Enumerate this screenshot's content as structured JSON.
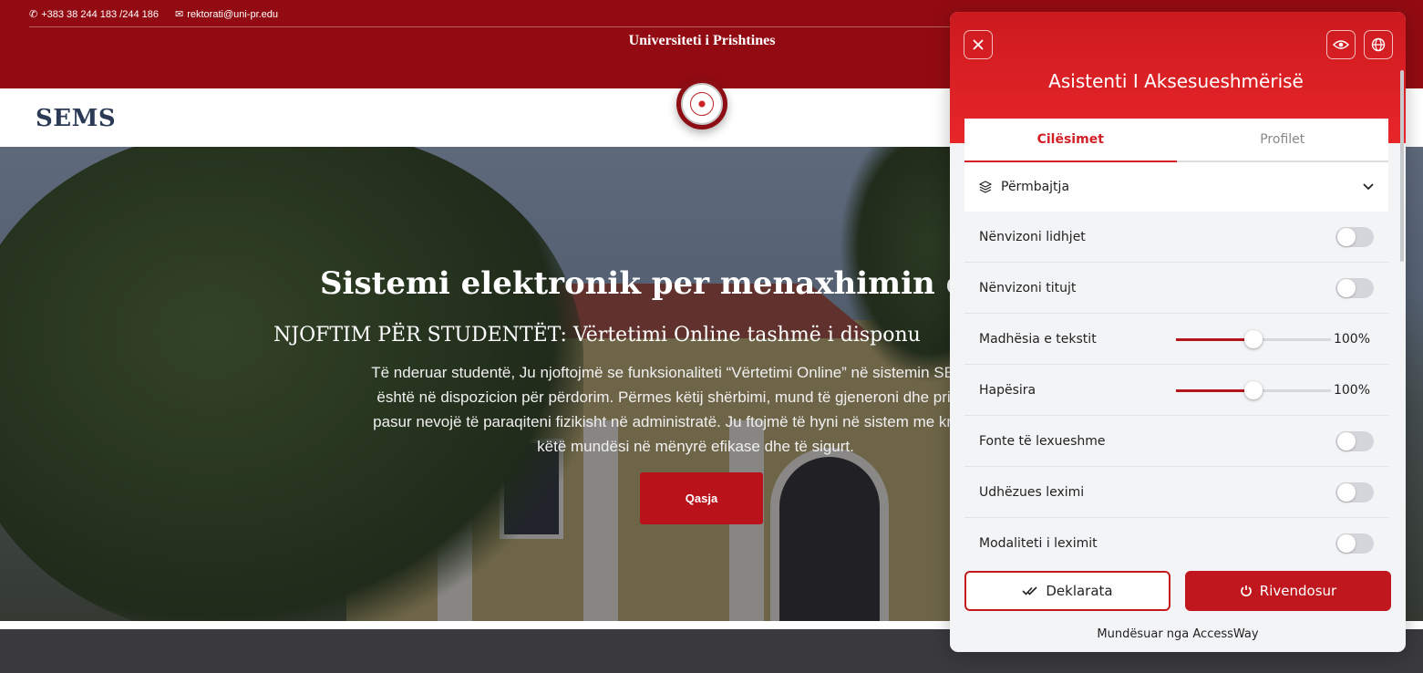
{
  "header": {
    "phone": "+383 38 244 183 /244 186",
    "email": "rektorati@uni-pr.edu",
    "university": "Universiteti i Prishtines",
    "brand": "SEMS"
  },
  "hero": {
    "title": "Sistemi elektronik per menaxhimin e stu",
    "notice": "NJOFTIM PËR STUDENTËT: Vërtetimi Online tashmë i disponu",
    "body_lines": [
      "Të nderuar studentë, Ju njoftojmë se funksionaliteti “Vërtetimi Online” në sistemin SEMS është",
      "është në dispozicion për përdorim. Përmes këtij shërbimi, mund të gjeneroni dhe printoni vërt",
      "pasur nevojë të paraqiteni fizikisht në administratë. Ju ftojmë të hyni në sistem me kredenciale",
      "këtë mundësi në mënyrë efikase dhe të sigurt."
    ],
    "button": "Qasja"
  },
  "panel": {
    "title": "Asistenti I Aksesueshmërisë",
    "tabs": [
      "Cilësimet",
      "Profilet"
    ],
    "active_tab": "Cilësimet",
    "section": "Përmbajtja",
    "rows": [
      {
        "label": "Nënvizoni lidhjet",
        "type": "toggle",
        "on": false
      },
      {
        "label": "Nënvizoni titujt",
        "type": "toggle",
        "on": false
      },
      {
        "label": "Madhësia e tekstit",
        "type": "slider",
        "value": "100%",
        "level": 0.5
      },
      {
        "label": "Hapësira",
        "type": "slider",
        "value": "100%",
        "level": 0.5
      },
      {
        "label": "Fonte të lexueshme",
        "type": "toggle",
        "on": false
      },
      {
        "label": "Udhëzues leximi",
        "type": "toggle",
        "on": false
      },
      {
        "label": "Modaliteti i leximit",
        "type": "toggle",
        "on": false
      }
    ],
    "btn_declaration": "Deklarata",
    "btn_reset": "Rivendosur",
    "powered_by": "Mundësuar nga AccessWay",
    "accent": "#d31f26"
  }
}
